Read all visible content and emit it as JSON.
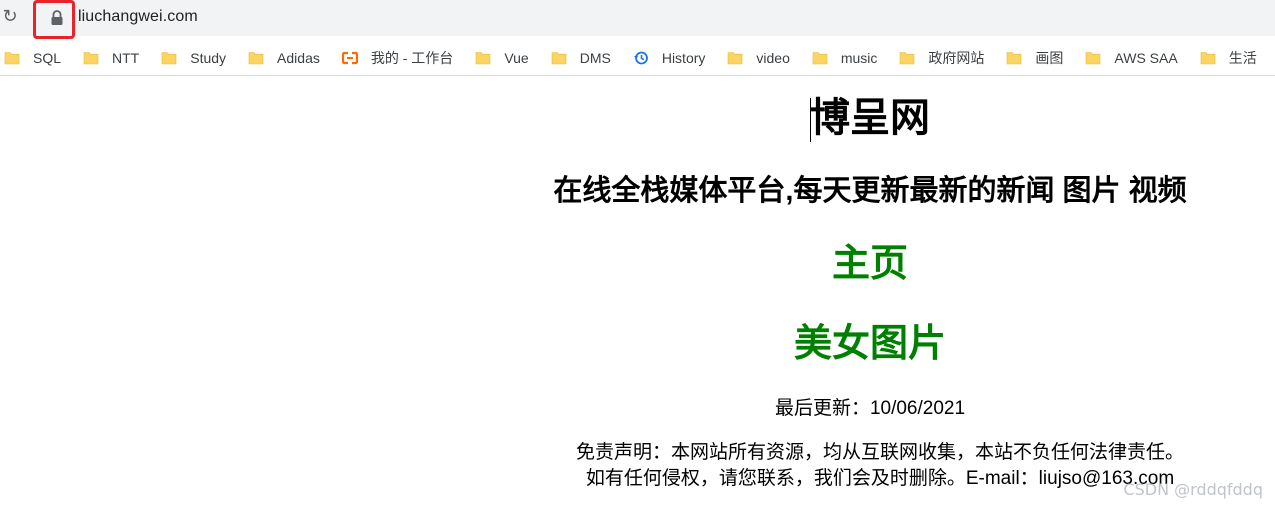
{
  "browser": {
    "url": "liuchangwei.com",
    "bookmarks": [
      {
        "label": "SQL",
        "icon": "folder-icon"
      },
      {
        "label": "NTT",
        "icon": "folder-icon"
      },
      {
        "label": "Study",
        "icon": "folder-icon"
      },
      {
        "label": "Adidas",
        "icon": "folder-icon"
      },
      {
        "label": "我的 - 工作台",
        "icon": "aliyun-icon"
      },
      {
        "label": "Vue",
        "icon": "folder-icon"
      },
      {
        "label": "DMS",
        "icon": "folder-icon"
      },
      {
        "label": "History",
        "icon": "history-icon"
      },
      {
        "label": "video",
        "icon": "folder-icon"
      },
      {
        "label": "music",
        "icon": "folder-icon"
      },
      {
        "label": "政府网站",
        "icon": "folder-icon"
      },
      {
        "label": "画图",
        "icon": "folder-icon"
      },
      {
        "label": "AWS SAA",
        "icon": "folder-icon"
      },
      {
        "label": "生活",
        "icon": "folder-icon"
      }
    ],
    "colors": {
      "highlight": "#e8232c",
      "folder": "#fcd462",
      "aliyun": "#ff6a00",
      "history": "#1a73e8"
    }
  },
  "page": {
    "title": "博呈网",
    "tagline": "在线全栈媒体平台,每天更新最新的新闻 图片 视频",
    "nav": {
      "home": "主页",
      "beauty": "美女图片"
    },
    "updated": "最后更新：10/06/2021",
    "disclaimer_line1": "免责声明：本网站所有资源，均从互联网收集，本站不负任何法律责任。",
    "disclaimer_line2": "如有任何侵权，请您联系，我们会及时删除。E-mail：liujso@163.com",
    "link_color": "#008000"
  },
  "watermark": "CSDN @rddqfddq"
}
